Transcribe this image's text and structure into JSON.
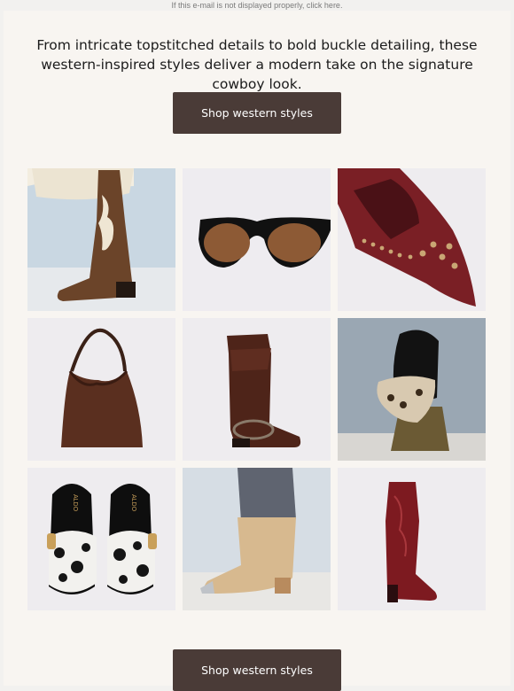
{
  "preheader": {
    "text": "If this e-mail is not displayed properly, click here."
  },
  "intro": {
    "text": "From intricate topstitched details to bold buckle detailing, these western-inspired styles deliver a modern take on the signature cowboy look."
  },
  "cta_top": {
    "label": "Shop western styles"
  },
  "cta_bottom": {
    "label": "Shop western styles"
  },
  "products": [
    {
      "name": "western-boot-brown-white",
      "brand_text": ""
    },
    {
      "name": "sunglasses-brown",
      "brand_text": ""
    },
    {
      "name": "studded-pump-burgundy",
      "brand_text": ""
    },
    {
      "name": "croc-hobo-bag-brown",
      "brand_text": ""
    },
    {
      "name": "fringe-tall-boot-brown",
      "brand_text": ""
    },
    {
      "name": "scarf-tied-black-bag",
      "brand_text": ""
    },
    {
      "name": "cow-print-clog",
      "brand_text": "ALDO"
    },
    {
      "name": "embroidered-bootie-beige",
      "brand_text": ""
    },
    {
      "name": "tall-western-boot-red",
      "brand_text": ""
    }
  ],
  "colors": {
    "page_bg": "#f2f1ef",
    "card_bg": "#f8f5f1",
    "button_bg": "#4a3b37",
    "button_text": "#ffffff",
    "body_text": "#1b1b1b"
  }
}
